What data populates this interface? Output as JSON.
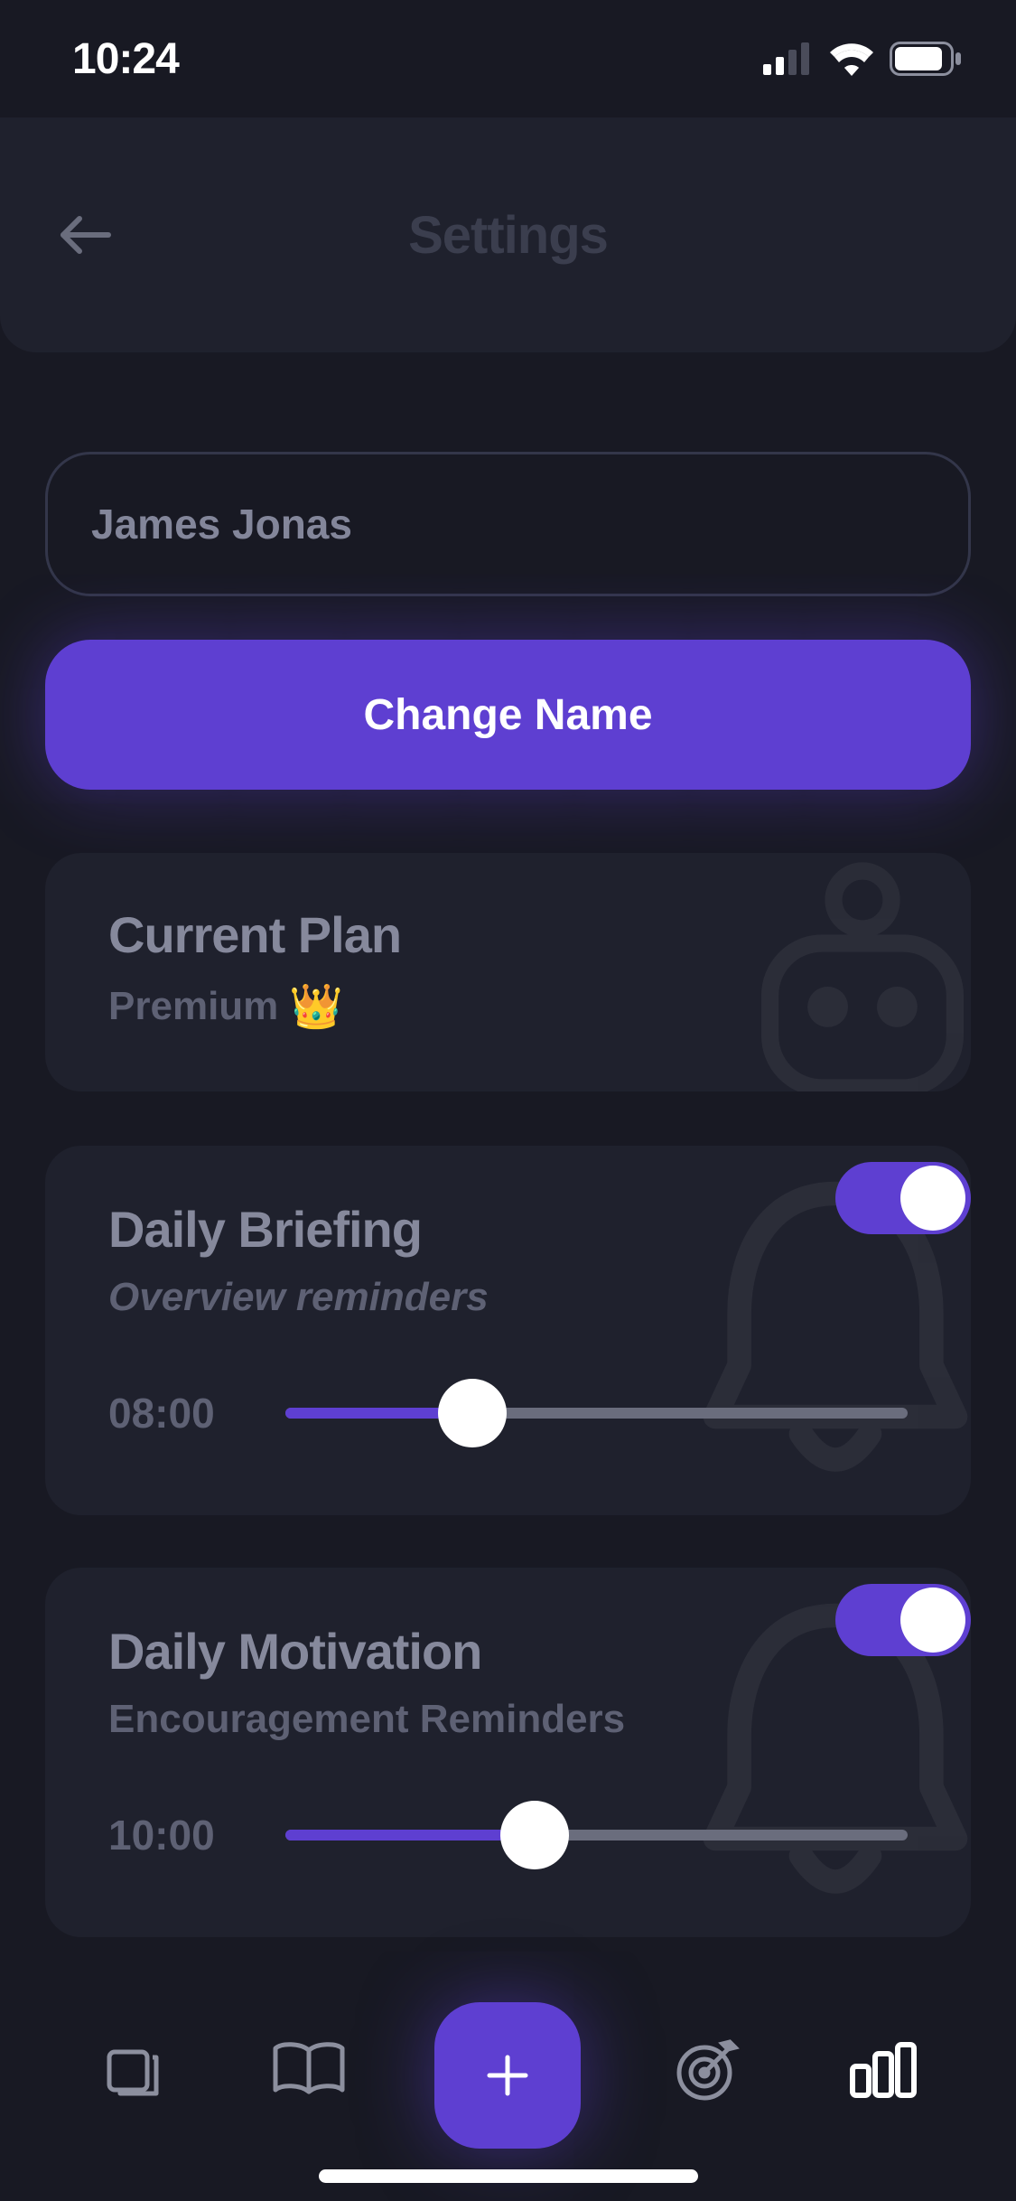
{
  "status": {
    "time": "10:24"
  },
  "header": {
    "title": "Settings"
  },
  "profile": {
    "name": "James Jonas",
    "change_name_label": "Change Name"
  },
  "plan": {
    "title": "Current Plan",
    "value": "Premium",
    "emoji": "👑"
  },
  "briefing": {
    "title": "Daily Briefing",
    "subtitle": "Overview reminders",
    "time": "08:00",
    "toggle": true,
    "slider_percent": 30
  },
  "motivation": {
    "title": "Daily Motivation",
    "subtitle": "Encouragement Reminders",
    "time": "10:00",
    "toggle": true,
    "slider_percent": 40
  },
  "colors": {
    "accent": "#5e3fd1",
    "bg": "#181923",
    "card": "#1f212d"
  }
}
